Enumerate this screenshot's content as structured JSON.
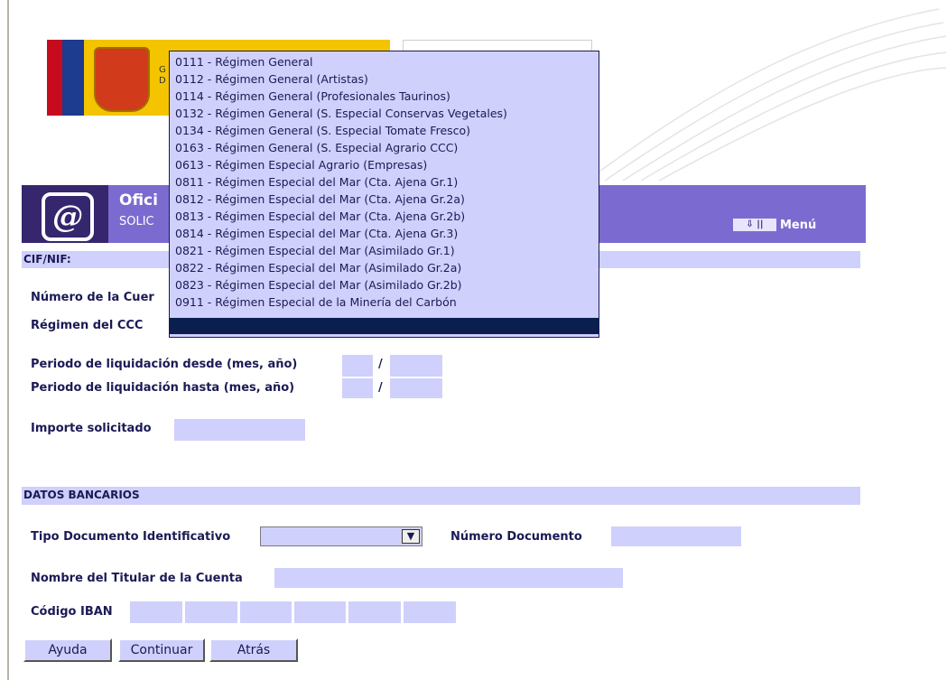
{
  "banner": {
    "title": "Ofici",
    "subtitle": "SOLIC",
    "menu_label": "Menú",
    "menu_icon": "arrow-down-icon"
  },
  "header": {
    "flag_text": "G\nD"
  },
  "cif": {
    "label": "CIF/NIF:"
  },
  "form": {
    "cuenta_label": "Número de la Cuer",
    "regimen_label": "Régimen del CCC",
    "desde_label": "Periodo de liquidación desde (mes, año)",
    "hasta_label": "Periodo de liquidación hasta (mes, año)",
    "slash": "/",
    "importe_label": "Importe solicitado"
  },
  "bancarios": {
    "section_label": "DATOS BANCARIOS",
    "tipo_doc_label": "Tipo Documento Identificativo",
    "tipo_doc_value": "",
    "numero_doc_label": "Número Documento",
    "titular_label": "Nombre del Titular de la Cuenta",
    "iban_label": "Código IBAN"
  },
  "buttons": {
    "ayuda": "Ayuda",
    "continuar": "Continuar",
    "atras": "Atrás"
  },
  "regimen_options": [
    "0111 - Régimen General",
    "0112 - Régimen General (Artistas)",
    "0114 - Régimen General (Profesionales Taurinos)",
    "0132 - Régimen General (S. Especial Conservas Vegetales)",
    "0134 - Régimen General (S. Especial Tomate Fresco)",
    "0163 - Régimen General (S. Especial Agrario CCC)",
    "0613 - Régimen Especial Agrario (Empresas)",
    "0811 - Régimen Especial del Mar (Cta. Ajena Gr.1)",
    "0812 - Régimen Especial del Mar (Cta. Ajena Gr.2a)",
    "0813 - Régimen Especial del Mar (Cta. Ajena Gr.2b)",
    "0814 - Régimen Especial del Mar (Cta. Ajena Gr.3)",
    "0821 - Régimen Especial del Mar (Asimilado Gr.1)",
    "0822 - Régimen Especial del Mar (Asimilado Gr.2a)",
    "0823 - Régimen Especial del Mar (Asimilado Gr.2b)",
    "0911 - Régimen Especial de la Minería del Carbón"
  ],
  "colors": {
    "field_bg": "#cfd0fb",
    "banner_bg": "#7b6bd0",
    "selected_bg": "#0b1f4f"
  }
}
